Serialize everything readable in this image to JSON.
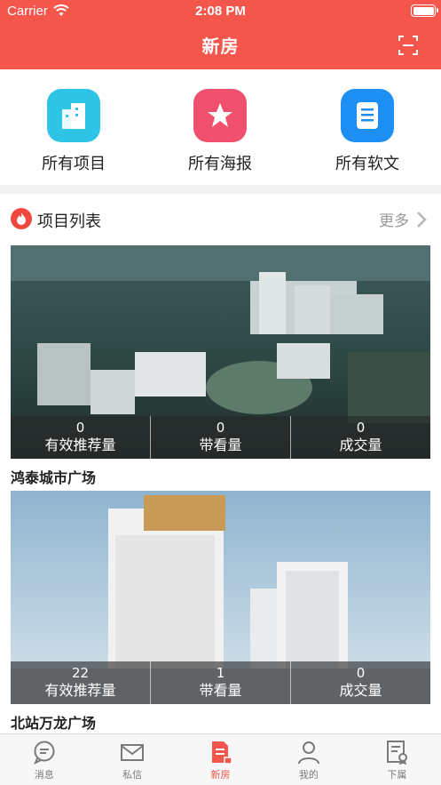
{
  "status_bar": {
    "carrier": "Carrier",
    "time": "2:08 PM"
  },
  "nav": {
    "title": "新房"
  },
  "quick_actions": [
    {
      "label": "所有项目",
      "icon": "building-icon",
      "color": "#2ec4e6"
    },
    {
      "label": "所有海报",
      "icon": "star-icon",
      "color": "#f0506e"
    },
    {
      "label": "所有软文",
      "icon": "document-icon",
      "color": "#1e8ff2"
    }
  ],
  "section": {
    "title": "项目列表",
    "more": "更多"
  },
  "projects": [
    {
      "name": "鸿泰城市广场",
      "stats": [
        {
          "value": "0",
          "label": "有效推荐量"
        },
        {
          "value": "0",
          "label": "带看量"
        },
        {
          "value": "0",
          "label": "成交量"
        }
      ]
    },
    {
      "name": "北站万龙广场",
      "stats": [
        {
          "value": "22",
          "label": "有效推荐量"
        },
        {
          "value": "1",
          "label": "带看量"
        },
        {
          "value": "0",
          "label": "成交量"
        }
      ]
    }
  ],
  "tabs": [
    {
      "label": "消息",
      "icon": "message-icon"
    },
    {
      "label": "私信",
      "icon": "mail-icon"
    },
    {
      "label": "新房",
      "icon": "new-house-icon",
      "active": true
    },
    {
      "label": "我的",
      "icon": "user-icon"
    },
    {
      "label": "下属",
      "icon": "subordinate-icon"
    }
  ],
  "colors": {
    "brand": "#f5564c",
    "tab_inactive": "#7a7a7a"
  }
}
